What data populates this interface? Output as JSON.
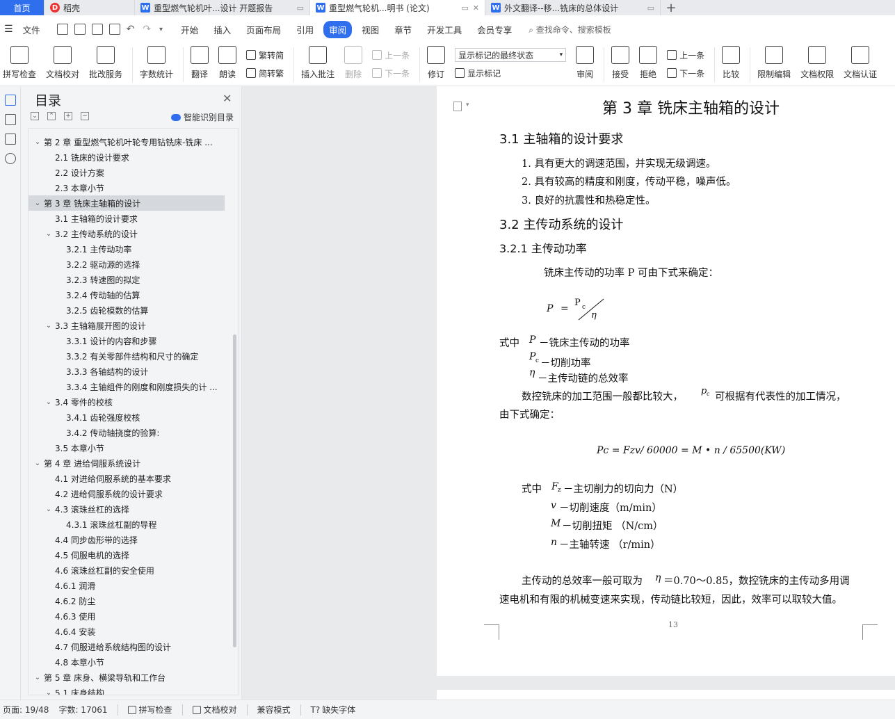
{
  "tabs": [
    {
      "label": "首页"
    },
    {
      "label": "稻壳"
    },
    {
      "label": "重型燃气轮机叶...设计 开题报告"
    },
    {
      "label": "重型燃气轮机...明书 (论文)"
    },
    {
      "label": "外文翻译--移...铣床的总体设计"
    }
  ],
  "menu": {
    "file": "文件",
    "items": [
      "开始",
      "插入",
      "页面布局",
      "引用",
      "审阅",
      "视图",
      "章节",
      "开发工具",
      "会员专享"
    ],
    "active": "审阅",
    "search_placeholder": "查找命令、搜索模板"
  },
  "ribbon": {
    "spellcheck": "拼写检查",
    "doccheck": "文档校对",
    "annotate_service": "批改服务",
    "wordcount": "字数统计",
    "translate": "翻译",
    "read_aloud": "朗读",
    "trad": "繁转简",
    "simp": "简转繁",
    "insert_comment": "插入批注",
    "delete": "删除",
    "prev_comment": "上一条",
    "next_comment": "下一条",
    "revise": "修订",
    "markup_state": "显示标记的最终状态",
    "show_markup": "显示标记",
    "review": "审阅",
    "accept": "接受",
    "reject": "拒绝",
    "prev_change": "上一条",
    "next_change": "下一条",
    "compare": "比较",
    "restrict_edit": "限制编辑",
    "doc_permission": "文档权限",
    "doc_cert": "文档认证"
  },
  "toc": {
    "title": "目录",
    "ai_label": "智能识别目录",
    "items": [
      {
        "level": 1,
        "toggle": "v",
        "text": "第 2 章  重型燃气轮机叶轮专用钻铣床-铣床 ..."
      },
      {
        "level": 2,
        "toggle": "",
        "text": "2.1  铣床的设计要求"
      },
      {
        "level": 2,
        "toggle": "",
        "text": "2.2  设计方案"
      },
      {
        "level": 2,
        "toggle": "",
        "text": "2.3  本章小节"
      },
      {
        "level": 1,
        "toggle": "v",
        "text": "第 3 章  铣床主轴箱的设计",
        "selected": true
      },
      {
        "level": 2,
        "toggle": "",
        "text": "3.1  主轴箱的设计要求"
      },
      {
        "level": 2,
        "toggle": "v",
        "text": "3.2 主传动系统的设计"
      },
      {
        "level": 3,
        "toggle": "",
        "text": "3.2.1  主传动功率"
      },
      {
        "level": 3,
        "toggle": "",
        "text": "3.2.2  驱动源的选择"
      },
      {
        "level": 3,
        "toggle": "",
        "text": "3.2.3  转速图的拟定"
      },
      {
        "level": 3,
        "toggle": "",
        "text": "3.2.4 传动轴的估算"
      },
      {
        "level": 3,
        "toggle": "",
        "text": "3.2.5 齿轮模数的估算"
      },
      {
        "level": 2,
        "toggle": "v",
        "text": "3.3 主轴箱展开图的设计"
      },
      {
        "level": 3,
        "toggle": "",
        "text": "3.3.1 设计的内容和步骤"
      },
      {
        "level": 3,
        "toggle": "",
        "text": "3.3.2  有关零部件结构和尺寸的确定"
      },
      {
        "level": 3,
        "toggle": "",
        "text": "3.3.3  各轴结构的设计"
      },
      {
        "level": 3,
        "toggle": "",
        "text": "3.3.4  主轴组件的刚度和刚度损失的计 ..."
      },
      {
        "level": 2,
        "toggle": "v",
        "text": "3.4  零件的校核"
      },
      {
        "level": 3,
        "toggle": "",
        "text": "3.4.1 齿轮强度校核"
      },
      {
        "level": 3,
        "toggle": "",
        "text": "3.4.2 传动轴挠度的验算:"
      },
      {
        "level": 2,
        "toggle": "",
        "text": "3.5  本章小节"
      },
      {
        "level": 1,
        "toggle": "v",
        "text": "第 4 章  进给伺服系统设计"
      },
      {
        "level": 2,
        "toggle": "",
        "text": "4.1  对进给伺服系统的基本要求"
      },
      {
        "level": 2,
        "toggle": "",
        "text": "4.2 进给伺服系统的设计要求"
      },
      {
        "level": 2,
        "toggle": "v",
        "text": "4.3 滚珠丝杠的选择"
      },
      {
        "level": 3,
        "toggle": "",
        "text": "4.3.1  滚珠丝杠副的导程"
      },
      {
        "level": 2,
        "toggle": "",
        "text": "4.4 同步齿形带的选择"
      },
      {
        "level": 2,
        "toggle": "",
        "text": "4.5 伺服电机的选择"
      },
      {
        "level": 2,
        "toggle": "",
        "text": "4.6  滚珠丝杠副的安全使用"
      },
      {
        "level": 2,
        "toggle": "",
        "text": "4.6.1  润滑"
      },
      {
        "level": 2,
        "toggle": "",
        "text": "4.6.2  防尘"
      },
      {
        "level": 2,
        "toggle": "",
        "text": "4.6.3 使用"
      },
      {
        "level": 2,
        "toggle": "",
        "text": "4.6.4  安装"
      },
      {
        "level": 2,
        "toggle": "",
        "text": "4.7  伺服进给系统结构图的设计"
      },
      {
        "level": 2,
        "toggle": "",
        "text": "4.8  本章小节"
      },
      {
        "level": 1,
        "toggle": "v",
        "text": "第 5 章  床身、横梁导轨和工作台"
      },
      {
        "level": 2,
        "toggle": "v",
        "text": "5.1  床身结构"
      }
    ]
  },
  "doc": {
    "chapter_title": "第 3 章  铣床主轴箱的设计",
    "s31": "3.1  主轴箱的设计要求",
    "req1": "1.  具有更大的调速范围，并实现无级调速。",
    "req2": "2.  具有较高的精度和刚度，传动平稳，噪声低。",
    "req3": "3.  良好的抗震性和热稳定性。",
    "s32": "3.2 主传动系统的设计",
    "s321": "3.2.1  主传动功率",
    "p1": "铣床主传动的功率 P  可由下式来确定：",
    "f1_lhs": "P",
    "f1_eq": "=",
    "f1_num": "P",
    "f1_sub": "c",
    "f1_den": "η",
    "where_label": "式中",
    "w1_sym": "P",
    "w1_txt": "－铣床主传动的功率",
    "w2_sym": "P",
    "w2_sub": "c",
    "w2_txt": "－切削功率",
    "w3_sym": "η",
    "w3_txt": "－主传动链的总效率",
    "p2a": "数控铣床的加工范围一般都比较大，",
    "p2_sym": "p",
    "p2_sub": "c",
    "p2b": "可根据有代表性的加工情况，",
    "p2c": "由下式确定：",
    "f2": "Pc = Fzv/ 60000 = M • n / 65500(KW)",
    "where2_label": "式中",
    "v1_sym": "F",
    "v1_sub": "z",
    "v1_txt": "－主切削力的切向力（N）",
    "v2_sym": "v",
    "v2_txt": "－切削速度（m/min）",
    "v3_sym": "M",
    "v3_txt": "－切削扭矩  （N/cm）",
    "v4_sym": "n",
    "v4_txt": "－主轴转速  （r/min）",
    "p3a": "主传动的总效率一般可取为",
    "p3_sym": "η",
    "p3b": "＝0.70～0.85，数控铣床的主传动多用调",
    "p3c": "速电机和有限的机械变速来实现，传动链比较短，因此，效率可以取较大值。",
    "page_number": "13"
  },
  "status": {
    "page": "页面: 19/48",
    "words": "字数: 17061",
    "spell": "拼写检查",
    "doccheck": "文档校对",
    "compat": "兼容模式",
    "missing_font": "缺失字体"
  },
  "colors": {
    "accent": "#2f6fed",
    "selected_toc": "#d5d9de",
    "panel_bg": "#f3f4f6",
    "doc_bg": "#e9eaec"
  }
}
